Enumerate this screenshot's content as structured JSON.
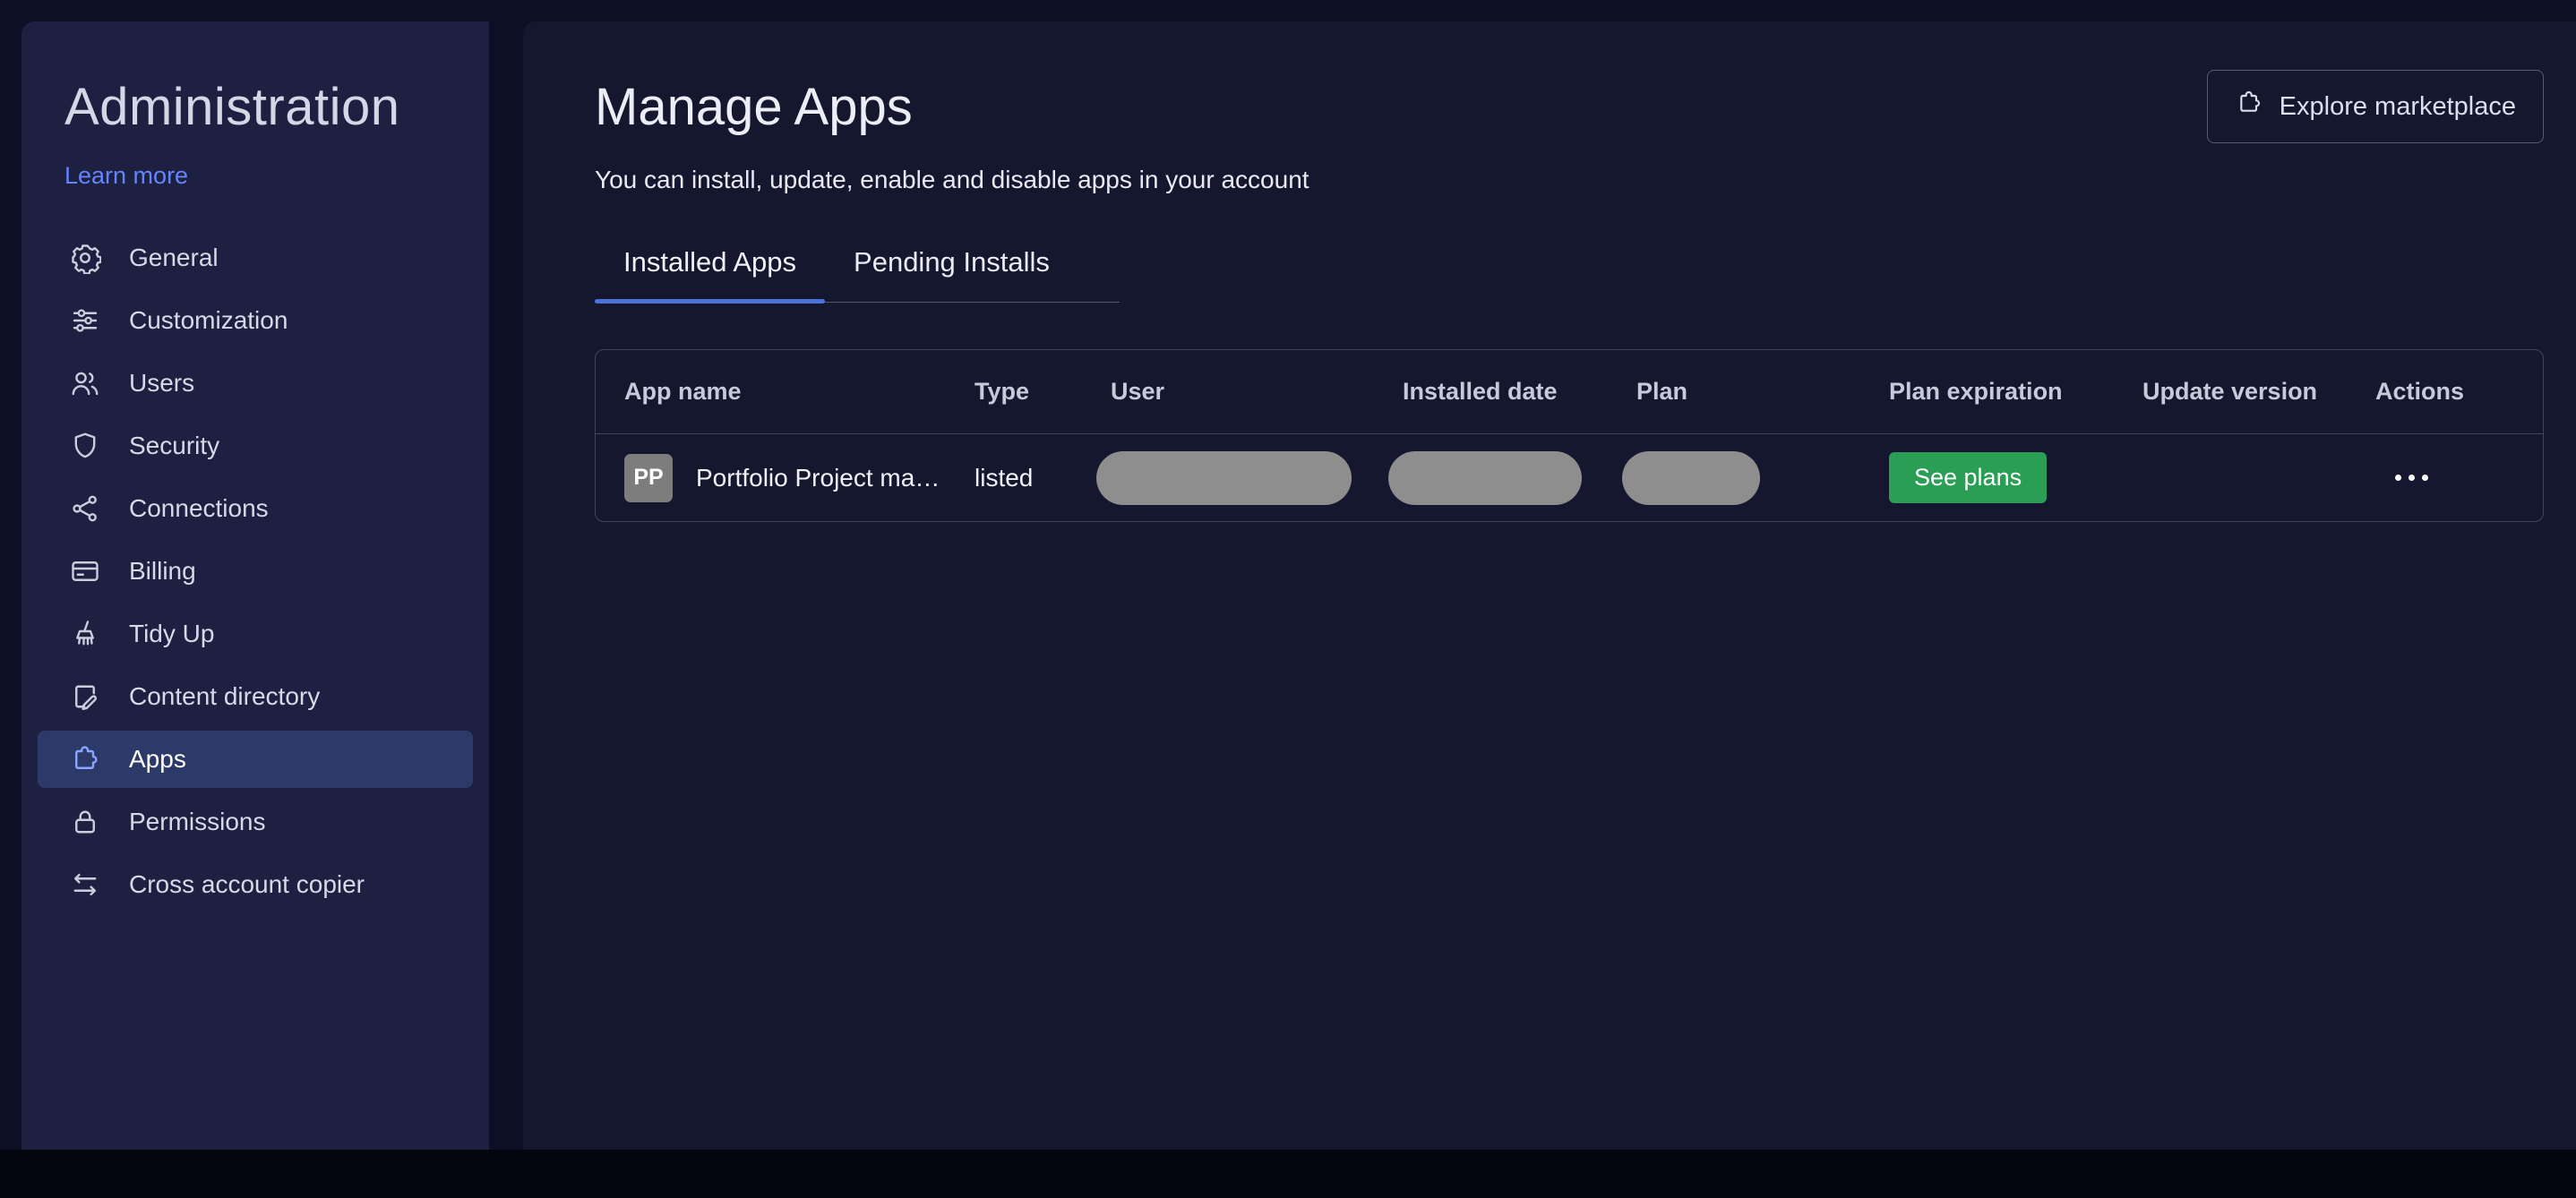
{
  "sidebar": {
    "title": "Administration",
    "learn_more_label": "Learn more",
    "items": [
      {
        "label": "General",
        "icon": "gear-icon"
      },
      {
        "label": "Customization",
        "icon": "sliders-icon"
      },
      {
        "label": "Users",
        "icon": "users-icon"
      },
      {
        "label": "Security",
        "icon": "shield-icon"
      },
      {
        "label": "Connections",
        "icon": "nodes-icon"
      },
      {
        "label": "Billing",
        "icon": "credit-card-icon"
      },
      {
        "label": "Tidy Up",
        "icon": "broom-icon"
      },
      {
        "label": "Content directory",
        "icon": "document-edit-icon"
      },
      {
        "label": "Apps",
        "icon": "puzzle-icon",
        "active": true
      },
      {
        "label": "Permissions",
        "icon": "lock-icon"
      },
      {
        "label": "Cross account copier",
        "icon": "swap-arrows-icon"
      }
    ]
  },
  "main": {
    "title": "Manage Apps",
    "subtitle": "You can install, update, enable and disable apps in your account",
    "explore_button_label": "Explore marketplace",
    "tabs": [
      {
        "label": "Installed Apps",
        "active": true
      },
      {
        "label": "Pending Installs",
        "active": false
      }
    ],
    "table": {
      "headers": [
        "App name",
        "Type",
        "User",
        "Installed date",
        "Plan",
        "Plan expiration",
        "Update version",
        "Actions"
      ],
      "rows": [
        {
          "avatar_initials": "PP",
          "app_name": "Portfolio Project ma…",
          "type": "listed",
          "redacted": {
            "user": true,
            "installed_date": true,
            "plan": true
          },
          "plan_expiration_button": "See plans",
          "actions_icon": "ellipsis-icon"
        }
      ]
    }
  },
  "colors": {
    "accent_blue": "#6584f8",
    "tab_underline": "#4a72d8",
    "selected_item_bg": "#2b3a68",
    "green_button": "#2b9e55",
    "redacted_pill": "#8e8e8e",
    "avatar_bg": "#7d7d7d"
  }
}
